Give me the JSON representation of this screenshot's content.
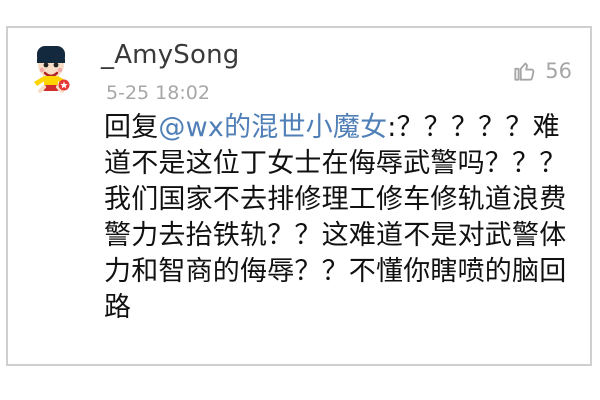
{
  "post": {
    "username": "_AmySong",
    "timestamp": "5-25 18:02",
    "likes": "56",
    "comment": {
      "reply_prefix": "回复",
      "mention": "@wx的混世小魔女",
      "line1_rest": ":？？？？？难",
      "lines": [
        "道不是这位丁女士在侮辱武警吗？？？",
        "我们国家不去排修理工修车修轨道浪费",
        "警力去抬铁轨？？这难道不是对武警体",
        "力和智商的侮辱？？不懂你瞎喷的脑回",
        "路"
      ]
    }
  },
  "colors": {
    "mention": "#4f7fb6",
    "text": "#111111",
    "meta": "#a7a7a7",
    "border": "#cfcfcf",
    "badge": "#e53935"
  },
  "icons": {
    "avatar": "cartoon-girl-avatar",
    "badge": "hong-kong-flower-badge",
    "like": "thumbs-up-icon"
  }
}
